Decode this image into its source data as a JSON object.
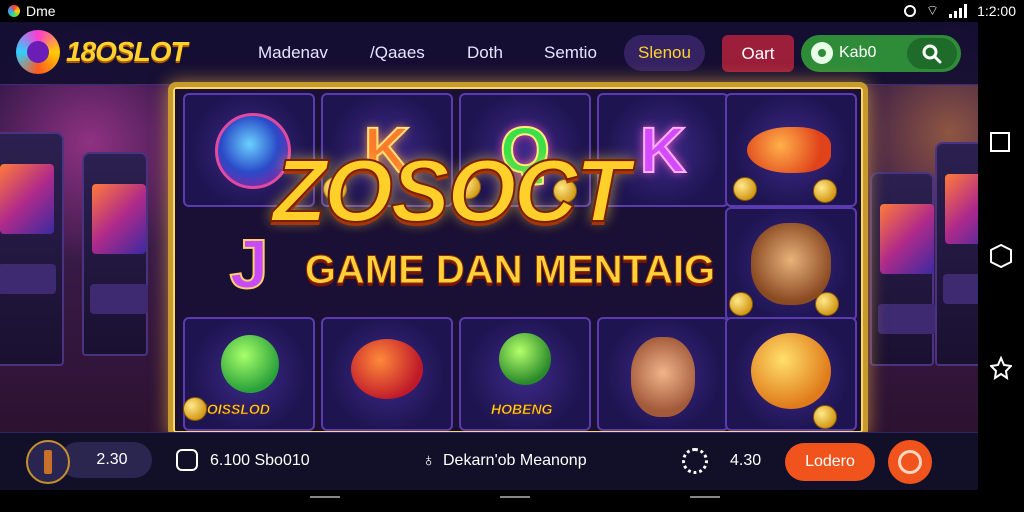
{
  "status_bar": {
    "left_text": "Dme",
    "time": "1:2:00"
  },
  "nav": {
    "logo_text": "18OSLOT",
    "items": [
      "Madenav",
      "/Qaaes",
      "Doth",
      "Semtio"
    ],
    "highlight_item": "Slenou",
    "red_button": "Oart",
    "green_button": "Kab0"
  },
  "reels": {
    "symbols": [
      "K",
      "Q",
      "K",
      "J"
    ],
    "labels": [
      "IOISSLOD",
      "HOBENG"
    ]
  },
  "hero": {
    "title": "ZOSOCT",
    "subtitle": "GAME DAN MENTAIG"
  },
  "bottom_bar": {
    "balance": "2.30",
    "coins": "6.100 Sbo010",
    "center_text": "Dekarn'ob Meanonp",
    "bet": "4.30",
    "action_button": "Lodero"
  },
  "colors": {
    "accent_gold": "#ffd22e",
    "action_orange": "#f0541c",
    "pill_green": "#2e8c39"
  }
}
